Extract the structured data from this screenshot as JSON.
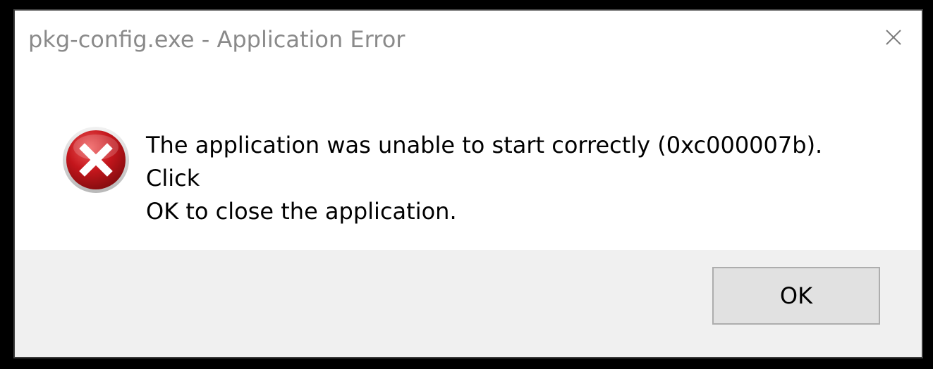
{
  "dialog": {
    "title": "pkg-config.exe - Application Error",
    "message_line1": "The application was unable to start correctly (0xc000007b). Click",
    "message_line2": "OK to close the application.",
    "icon": "error-icon",
    "close_icon": "close-icon",
    "ok_label": "OK"
  },
  "colors": {
    "title_text": "#8a8a8a",
    "footer_bg": "#f0f0f0",
    "button_bg": "#e1e1e1",
    "button_border": "#adadad",
    "error_red": "#c4161c"
  }
}
